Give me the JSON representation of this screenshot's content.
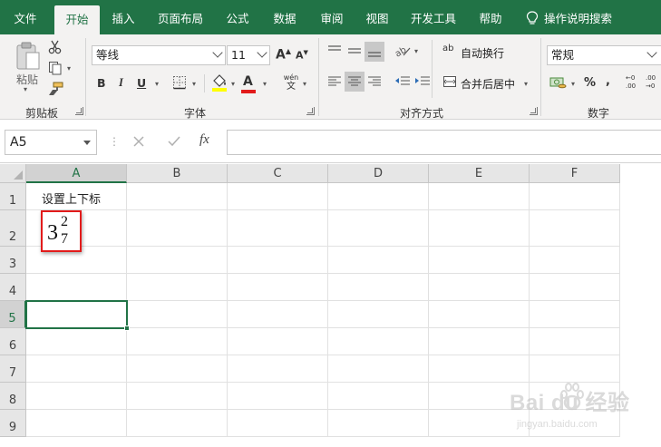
{
  "tabs": [
    {
      "label": "文件",
      "active": false
    },
    {
      "label": "开始",
      "active": true
    },
    {
      "label": "插入",
      "active": false
    },
    {
      "label": "页面布局",
      "active": false
    },
    {
      "label": "公式",
      "active": false
    },
    {
      "label": "数据",
      "active": false
    },
    {
      "label": "审阅",
      "active": false
    },
    {
      "label": "视图",
      "active": false
    },
    {
      "label": "开发工具",
      "active": false
    },
    {
      "label": "帮助",
      "active": false
    }
  ],
  "tell_me": {
    "icon": "lightbulb-icon",
    "label": "操作说明搜索"
  },
  "ribbon": {
    "clipboard": {
      "paste_label": "粘贴",
      "group_label": "剪贴板"
    },
    "font": {
      "font_name": "等线",
      "font_size": "11",
      "bold": "B",
      "italic": "I",
      "underline": "U",
      "grow_font": "A",
      "shrink_font": "A",
      "font_color_letter": "A",
      "phonetic_top": "wén",
      "phonetic_bottom": "文",
      "group_label": "字体",
      "highlight_color": "#ffff00",
      "font_color": "#e21b1b"
    },
    "alignment": {
      "wrap_text": "自动换行",
      "merge_center": "合并后居中",
      "wrap_icon_text": "ab",
      "group_label": "对齐方式"
    },
    "number": {
      "format": "常规",
      "percent": "%",
      "comma": ",",
      "inc_decimal_top": "←0",
      "inc_decimal_bottom": ".00",
      "dec_decimal_top": ".00",
      "dec_decimal_bottom": "→0",
      "group_label": "数字"
    }
  },
  "formula_bar": {
    "name_box": "A5",
    "fx_label": "fx",
    "formula": ""
  },
  "sheet": {
    "columns": [
      "A",
      "B",
      "C",
      "D",
      "E",
      "F"
    ],
    "rows": [
      "1",
      "2",
      "3",
      "4",
      "5",
      "6",
      "7",
      "8",
      "9"
    ],
    "selected_column": "A",
    "selected_row": "5",
    "cells": {
      "A1": "设置上下标",
      "A2": {
        "whole": "3",
        "superscript": "2",
        "subscript": "7"
      }
    }
  },
  "watermark": {
    "brand": "Bai du 经验",
    "sub": "jingyan.baidu.com"
  },
  "colors": {
    "excel_green": "#217346",
    "highlight_box": "#e21b1b"
  }
}
